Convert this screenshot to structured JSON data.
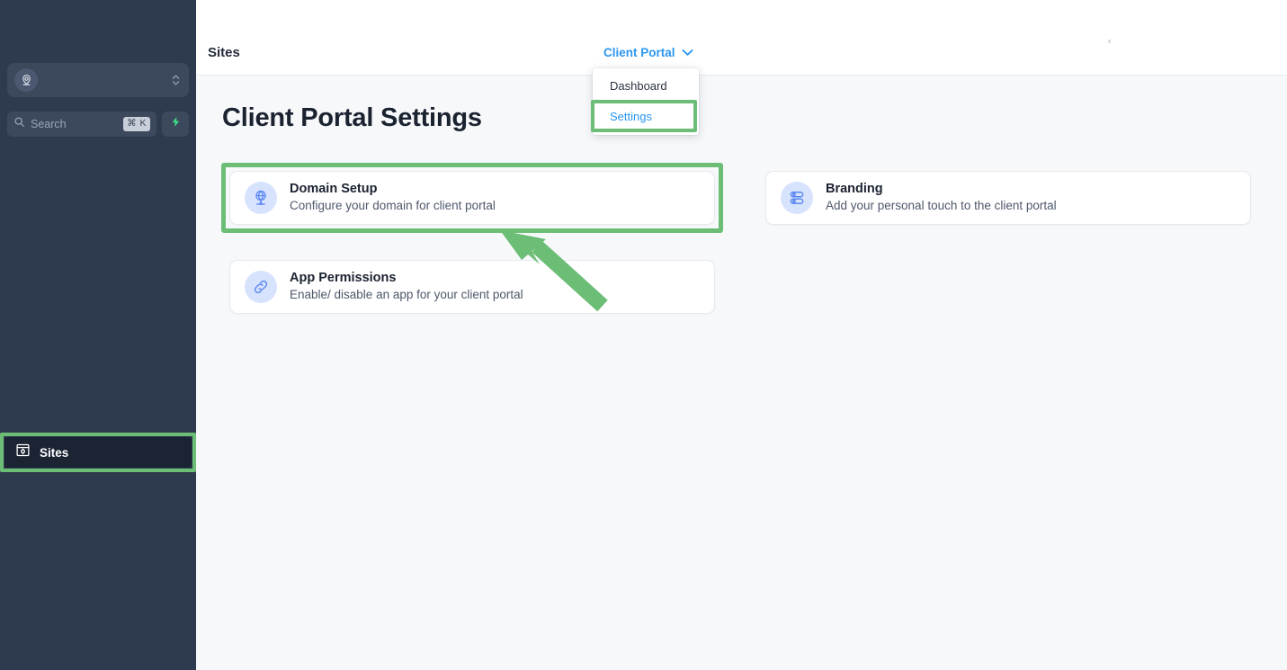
{
  "sidebar": {
    "workspace": {
      "icon": "user-location-avatar-icon",
      "name": "",
      "chevron_icon": "chevron-up-down-icon"
    },
    "search": {
      "placeholder": "Search",
      "shortcut": "⌘ K",
      "icon": "search-icon"
    },
    "quick_action": {
      "icon": "lightning-bolt-icon",
      "color": "#3ddc84"
    },
    "nav_items": [
      {
        "label": "Sites",
        "icon": "sites-window-icon",
        "active": true,
        "highlighted": true
      }
    ]
  },
  "topbar": {
    "title": "Sites",
    "portal_switcher": {
      "label": "Client Portal",
      "chevron_icon": "chevron-down-icon",
      "expanded": true
    }
  },
  "dropdown": {
    "items": [
      {
        "label": "Dashboard",
        "active": false,
        "highlighted": false
      },
      {
        "label": "Settings",
        "active": true,
        "highlighted": true
      }
    ]
  },
  "page": {
    "title": "Client Portal Settings",
    "cards": [
      {
        "id": "domain",
        "title": "Domain Setup",
        "subtitle": "Configure your domain for client portal",
        "icon": "globe-network-icon",
        "highlighted": true
      },
      {
        "id": "branding",
        "title": "Branding",
        "subtitle": "Add your personal touch to the client portal",
        "icon": "sliders-adjust-icon",
        "highlighted": false
      },
      {
        "id": "apps",
        "title": "App Permissions",
        "subtitle": "Enable/ disable an app for your client portal",
        "icon": "link-chain-icon",
        "highlighted": false
      }
    ]
  },
  "annotations": {
    "arrow": {
      "color": "#6cbe76",
      "points_to": "Domain Setup card"
    },
    "highlight_color": "#6cbe76"
  },
  "colors": {
    "sidebar_bg": "#2e3a4d",
    "accent_blue": "#2a96ef",
    "icon_bg": "#d7e3fd",
    "icon_blue": "#5b88f0",
    "content_bg": "#f7f8fa",
    "highlight_green": "#6cbe76"
  }
}
